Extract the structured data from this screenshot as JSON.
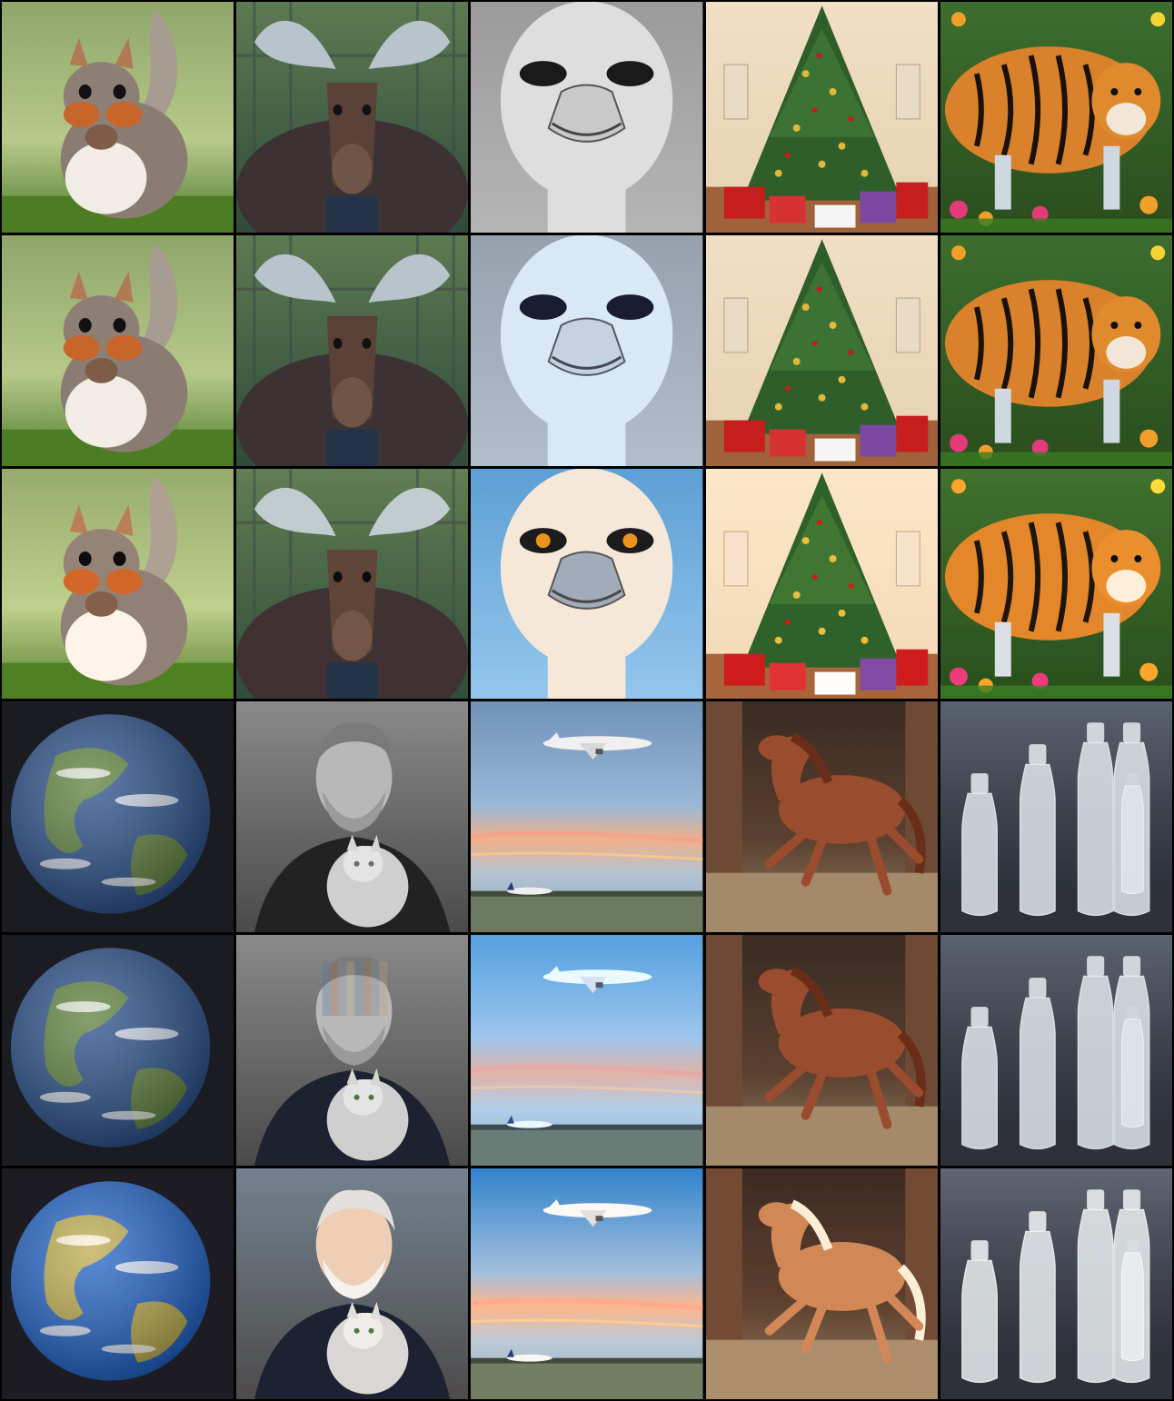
{
  "grid": {
    "rows": 6,
    "columns": 5
  },
  "tiles": [
    {
      "row": 1,
      "col": 1,
      "subject": "squirrel",
      "style": "photo"
    },
    {
      "row": 1,
      "col": 2,
      "subject": "moose",
      "style": "photo"
    },
    {
      "row": 1,
      "col": 3,
      "subject": "ostrich",
      "style": "grayscale"
    },
    {
      "row": 1,
      "col": 4,
      "subject": "christmas-tree",
      "style": "photo"
    },
    {
      "row": 1,
      "col": 5,
      "subject": "tiger",
      "style": "photo"
    },
    {
      "row": 2,
      "col": 1,
      "subject": "squirrel",
      "style": "photo"
    },
    {
      "row": 2,
      "col": 2,
      "subject": "moose",
      "style": "photo"
    },
    {
      "row": 2,
      "col": 3,
      "subject": "ostrich",
      "style": "tinted"
    },
    {
      "row": 2,
      "col": 4,
      "subject": "christmas-tree",
      "style": "photo"
    },
    {
      "row": 2,
      "col": 5,
      "subject": "tiger",
      "style": "photo"
    },
    {
      "row": 3,
      "col": 1,
      "subject": "squirrel",
      "style": "illustration"
    },
    {
      "row": 3,
      "col": 2,
      "subject": "moose",
      "style": "illustration"
    },
    {
      "row": 3,
      "col": 3,
      "subject": "ostrich",
      "style": "illustration"
    },
    {
      "row": 3,
      "col": 4,
      "subject": "christmas-tree",
      "style": "illustration"
    },
    {
      "row": 3,
      "col": 5,
      "subject": "tiger",
      "style": "illustration"
    },
    {
      "row": 4,
      "col": 1,
      "subject": "earth",
      "style": "photo"
    },
    {
      "row": 4,
      "col": 2,
      "subject": "man-with-cat",
      "style": "grayscale"
    },
    {
      "row": 4,
      "col": 3,
      "subject": "airplane",
      "style": "photo"
    },
    {
      "row": 4,
      "col": 4,
      "subject": "horse",
      "style": "photo"
    },
    {
      "row": 4,
      "col": 5,
      "subject": "bottles",
      "style": "photo"
    },
    {
      "row": 5,
      "col": 1,
      "subject": "earth",
      "style": "photo"
    },
    {
      "row": 5,
      "col": 2,
      "subject": "man-with-cat",
      "style": "artifacted"
    },
    {
      "row": 5,
      "col": 3,
      "subject": "airplane",
      "style": "tinted"
    },
    {
      "row": 5,
      "col": 4,
      "subject": "horse",
      "style": "photo"
    },
    {
      "row": 5,
      "col": 5,
      "subject": "bottles",
      "style": "photo"
    },
    {
      "row": 6,
      "col": 1,
      "subject": "earth",
      "style": "illustration"
    },
    {
      "row": 6,
      "col": 2,
      "subject": "man-with-cat",
      "style": "illustration"
    },
    {
      "row": 6,
      "col": 3,
      "subject": "airplane",
      "style": "illustration"
    },
    {
      "row": 6,
      "col": 4,
      "subject": "horse",
      "style": "illustration"
    },
    {
      "row": 6,
      "col": 5,
      "subject": "bottles",
      "style": "illustration"
    }
  ]
}
